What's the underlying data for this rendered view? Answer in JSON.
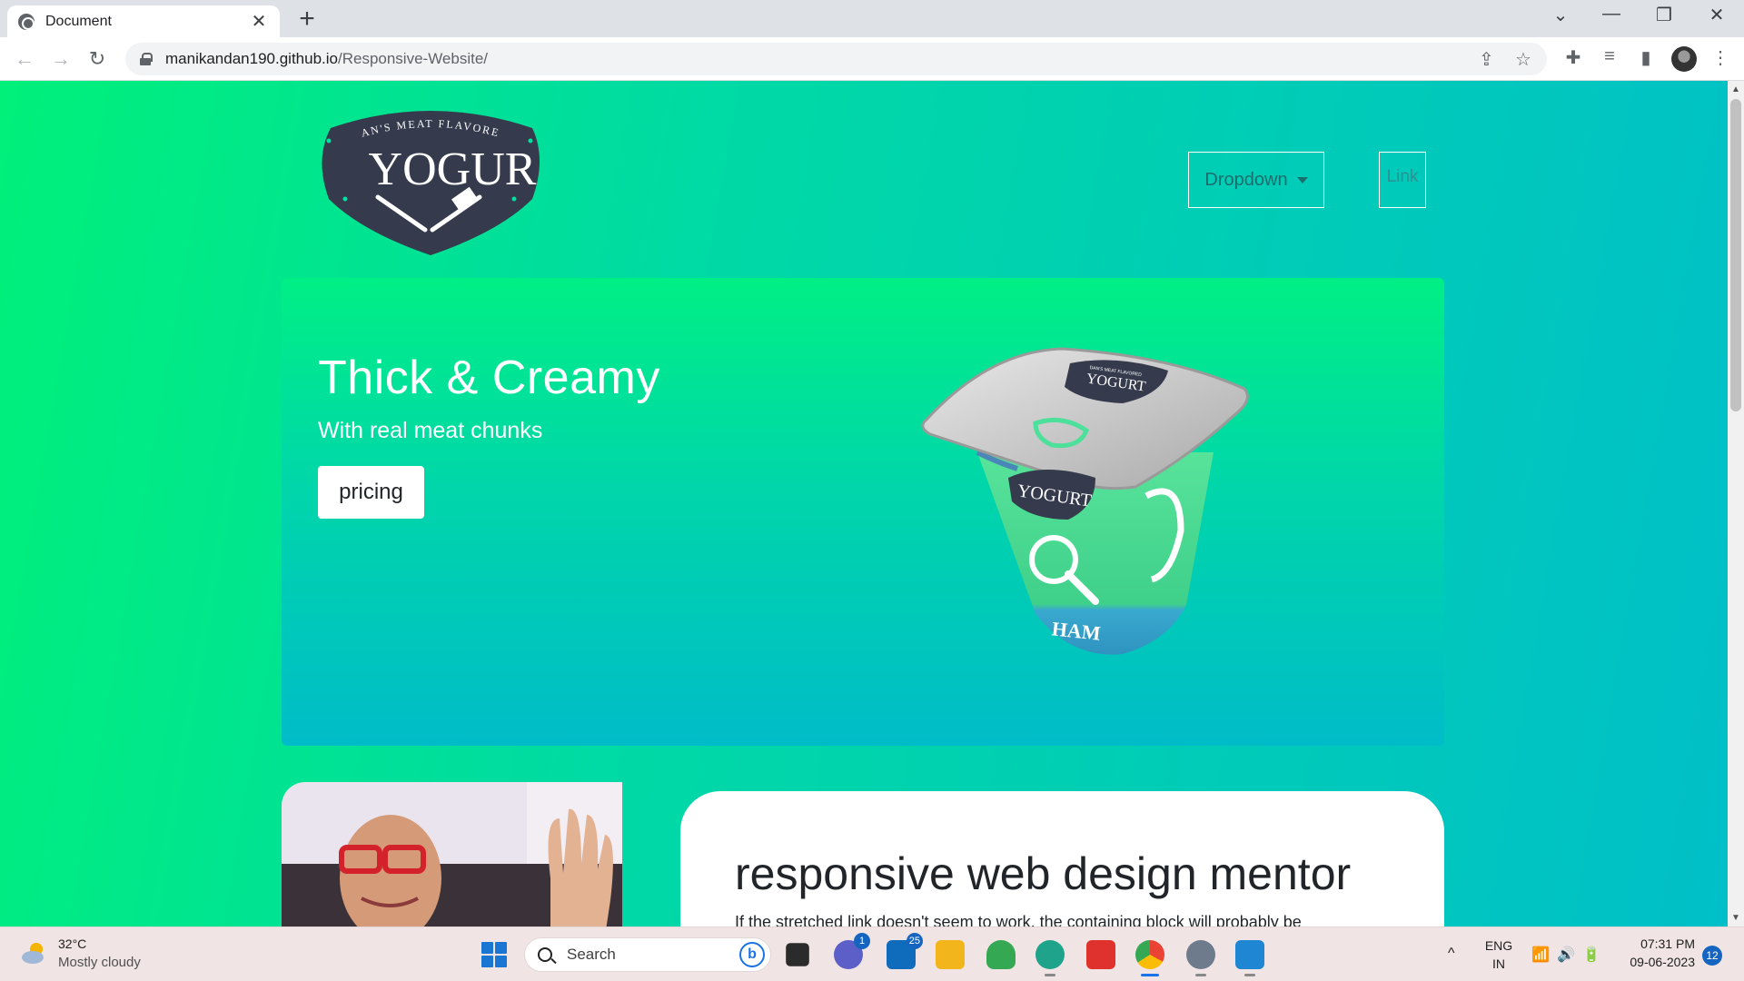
{
  "browser": {
    "tab_title": "Document",
    "tab_close": "✕",
    "new_tab": "+",
    "url_host": "manikandan190.github.io",
    "url_path": "/Responsive-Website/",
    "nav": {
      "back": "←",
      "forward": "→",
      "reload": "↻"
    },
    "window_controls": {
      "tabs_menu": "⌄",
      "minimize": "—",
      "restore": "❐",
      "close": "✕"
    },
    "toolbar_icons": {
      "share": "⇪",
      "bookmark": "☆",
      "extensions": "✚",
      "media": "≡",
      "sidepanel": "▮",
      "menu": "⋮"
    }
  },
  "page": {
    "logo": {
      "top_text": "DAN'S MEAT FLAVORED",
      "main_text": "YOGUR"
    },
    "nav": {
      "dropdown_label": "Dropdown",
      "link_label": "Link"
    },
    "hero": {
      "title": "Thick & Creamy",
      "subtitle": "With real meat chunks",
      "button_label": "pricing",
      "product": {
        "lid_brand_top": "DAN'S MEAT FLAVORED",
        "lid_brand": "YOGURT",
        "cup_brand": "YOGURT",
        "flavor": "HAM"
      }
    },
    "mentor": {
      "title": "responsive web design mentor",
      "text": "If the stretched link doesn't seem to work, the containing block will probably be"
    }
  },
  "taskbar": {
    "weather": {
      "temp": "32°C",
      "desc": "Mostly cloudy"
    },
    "search_placeholder": "Search",
    "bing_glyph": "b",
    "apps": [
      {
        "name": "task-view",
        "badge": ""
      },
      {
        "name": "teams",
        "badge": "1"
      },
      {
        "name": "mail",
        "badge": "25"
      },
      {
        "name": "file-explorer",
        "badge": ""
      },
      {
        "name": "rocket-app",
        "badge": ""
      },
      {
        "name": "edge",
        "badge": ""
      },
      {
        "name": "wps-office",
        "badge": ""
      },
      {
        "name": "chrome",
        "badge": ""
      },
      {
        "name": "settings",
        "badge": ""
      },
      {
        "name": "vscode",
        "badge": ""
      }
    ],
    "tray": {
      "chevron": "^",
      "lang_top": "ENG",
      "lang_bottom": "IN",
      "time": "07:31 PM",
      "date": "09-06-2023",
      "notifications": "12"
    }
  }
}
